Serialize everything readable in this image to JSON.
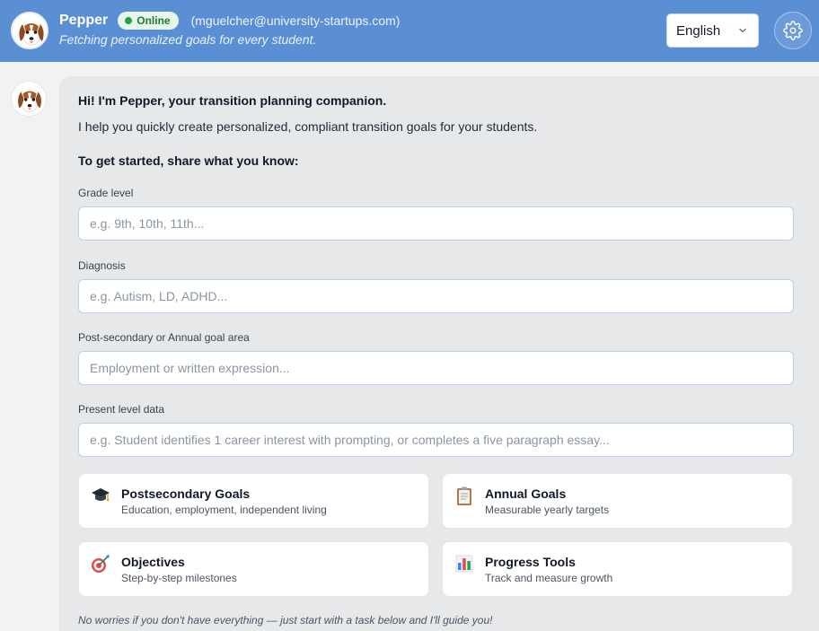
{
  "header": {
    "name": "Pepper",
    "status": "Online",
    "email": "(mguelcher@university-startups.com)",
    "subtitle": "Fetching personalized goals for every student.",
    "language": "English",
    "settings_icon": "gear-icon",
    "avatar_icon": "dog-avatar"
  },
  "chat": {
    "greeting": "Hi! I'm Pepper, your transition planning companion.",
    "intro": "I help you quickly create personalized, compliant transition goals for your students.",
    "prompt": "To get started, share what you know:",
    "fields": [
      {
        "label": "Grade level",
        "placeholder": "e.g. 9th, 10th, 11th..."
      },
      {
        "label": "Diagnosis",
        "placeholder": "e.g. Autism, LD, ADHD..."
      },
      {
        "label": "Post-secondary or Annual goal area",
        "placeholder": "Employment or written expression..."
      },
      {
        "label": "Present level data",
        "placeholder": "e.g. Student identifies 1 career interest with prompting, or completes a five paragraph essay..."
      }
    ],
    "cards": [
      {
        "title": "Postsecondary Goals",
        "desc": "Education, employment, independent living",
        "icon": "graduation-cap-icon"
      },
      {
        "title": "Annual Goals",
        "desc": "Measurable yearly targets",
        "icon": "clipboard-icon"
      },
      {
        "title": "Objectives",
        "desc": "Step-by-step milestones",
        "icon": "target-icon"
      },
      {
        "title": "Progress Tools",
        "desc": "Track and measure growth",
        "icon": "bar-chart-icon"
      }
    ],
    "footer": "No worries if you don't have everything — just start with a task below and I'll guide you!"
  },
  "colors": {
    "header": "#5b8fd4",
    "bubble": "#e7e8ea",
    "online": "#22a447"
  }
}
